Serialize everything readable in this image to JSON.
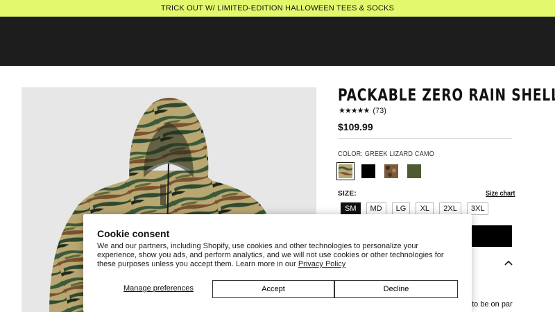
{
  "promo": {
    "text": "TRICK OUT W/ LIMITED-EDITION HALLOWEEN TEES & SOCKS"
  },
  "product": {
    "title": "PACKABLE ZERO RAIN SHELL",
    "stars": "★★★★★",
    "review_count": "(73)",
    "price": "$109.99",
    "color_label": "COLOR: GREEK LIZARD CAMO",
    "swatches": [
      {
        "name": "Greek Lizard Camo",
        "color": "#6f6a3d",
        "selected": true
      },
      {
        "name": "Black",
        "color": "#000000",
        "selected": false
      },
      {
        "name": "Brown Camo",
        "color": "#7a5a3c",
        "selected": false
      },
      {
        "name": "Olive",
        "color": "#4e5a34",
        "selected": false
      }
    ],
    "size_label": "SIZE:",
    "size_chart": "Size chart",
    "sizes": [
      "SM",
      "MD",
      "LG",
      "XL",
      "2XL",
      "3XL"
    ],
    "selected_size": "SM",
    "description_fragment": "to be on par"
  },
  "cookie": {
    "title": "Cookie consent",
    "body": "We and our partners, including Shopify, use cookies and other technologies to personalize your experience, show you ads, and perform analytics, and we will not use cookies or other technologies for these purposes unless you accept them. Learn more in our ",
    "privacy_link": "Privacy Policy",
    "manage": "Manage preferences",
    "accept": "Accept",
    "decline": "Decline"
  },
  "colors": {
    "promo_bg": "#e4f86e",
    "header_bg": "#1d1d1d",
    "image_bg": "#e7e7e7"
  }
}
